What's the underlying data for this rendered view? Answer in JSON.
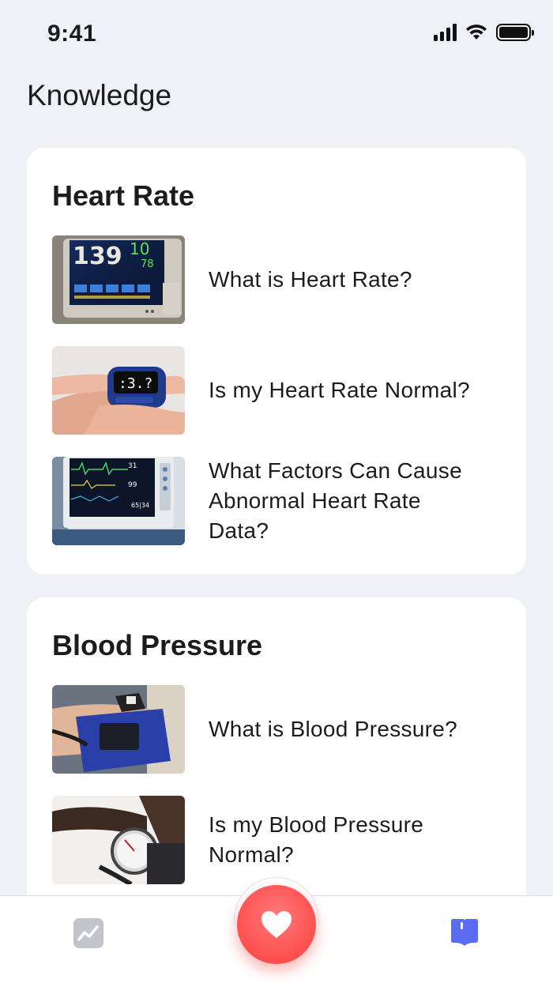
{
  "status_bar": {
    "time": "9:41",
    "icons": [
      "signal-icon",
      "wifi-icon",
      "battery-icon"
    ]
  },
  "page": {
    "title": "Knowledge"
  },
  "sections": [
    {
      "title": "Heart Rate",
      "items": [
        {
          "label": "What is Heart Rate?",
          "image": "patient-monitor-photo"
        },
        {
          "label": "Is my Heart Rate Normal?",
          "image": "pulse-oximeter-photo"
        },
        {
          "label_lines": [
            "What Factors Can Cause",
            "Abnormal Heart Rate",
            "Data?"
          ],
          "image": "ecg-monitor-photo"
        }
      ]
    },
    {
      "title": "Blood Pressure",
      "items": [
        {
          "label": "What is Blood Pressure?",
          "image": "bp-cuff-photo"
        },
        {
          "label_lines": [
            "Is my Blood Pressure",
            "Normal?"
          ],
          "image": "sphygmomanometer-photo"
        }
      ]
    }
  ],
  "tabbar": {
    "left_icon": "trend-chart-icon",
    "center_icon": "heart-icon",
    "right_icon": "book-icon",
    "colors": {
      "fab": "#ff5a5a",
      "active": "#5b6cf0",
      "inactive": "#c4c4cc"
    }
  }
}
